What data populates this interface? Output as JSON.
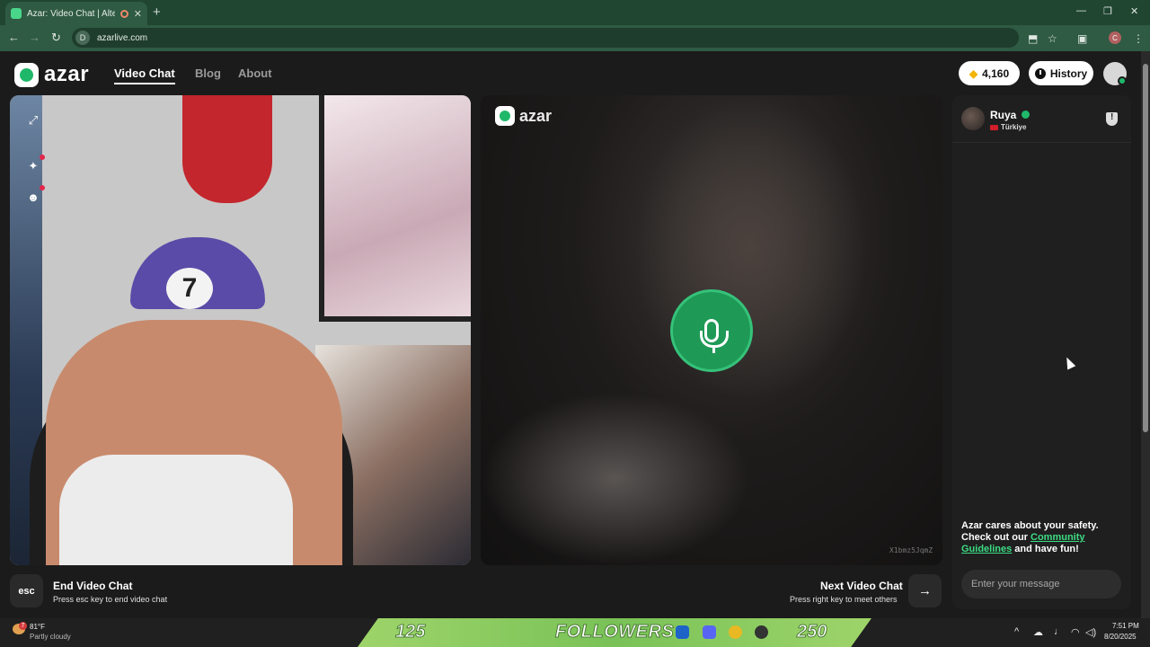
{
  "browser": {
    "tab_title": "Azar: Video Chat | Alternati",
    "new_tab_glyph": "+",
    "tab_close_glyph": "✕",
    "url": "azarlive.com",
    "site_glyph": "D",
    "profile_initial": "C",
    "back_glyph": "←",
    "forward_glyph": "→",
    "reload_glyph": "↻",
    "minimize_glyph": "—",
    "restore_glyph": "❐",
    "close_glyph": "✕",
    "menu_glyph": "⋮",
    "star_glyph": "☆",
    "install_glyph": "⬒",
    "sidepanel_glyph": "▣"
  },
  "header": {
    "logo_text": "azar",
    "nav": [
      {
        "label": "Video Chat",
        "active": true
      },
      {
        "label": "Blog",
        "active": false
      },
      {
        "label": "About",
        "active": false
      }
    ],
    "gems": "4,160",
    "history_label": "History"
  },
  "local_video": {
    "cap_number": "7",
    "tools": [
      {
        "icon": "fullscreen-icon",
        "glyph": "⤢"
      },
      {
        "icon": "effects-sparkle-icon",
        "glyph": "✦"
      },
      {
        "icon": "face-filter-icon",
        "glyph": "☻"
      }
    ]
  },
  "remote_video": {
    "logo_text": "azar",
    "watermark": "X1bmz5JqmZ"
  },
  "chat": {
    "peer_name": "Ruya",
    "peer_country": "Türkiye",
    "safety_text_1": "Azar cares about your safety. Check out our ",
    "safety_link": "Community Guidelines",
    "safety_text_2": " and have fun!",
    "input_placeholder": "Enter your message"
  },
  "controls": {
    "esc_key": "esc",
    "end_title": "End Video Chat",
    "end_sub": "Press esc key to end video chat",
    "next_title": "Next Video Chat",
    "next_sub": "Press right key to meet others",
    "next_glyph": "→"
  },
  "taskbar": {
    "weather_badge": "7",
    "weather_temp": "81°F",
    "weather_desc": "Partly cloudy",
    "followers_left": "125",
    "followers_label": "FOLLOWERS",
    "followers_right": "250",
    "time": "7:51 PM",
    "date": "8/20/2025",
    "tray_chevron": "^",
    "tray_wifi": "◠",
    "tray_volume": "◁)",
    "tray_mic": "♩"
  },
  "colors": {
    "brand_green": "#1fb86a",
    "link_green": "#3ddc84",
    "chrome_green": "#2f5a43",
    "background": "#1b1b1b",
    "notification_red": "#e2264a"
  }
}
